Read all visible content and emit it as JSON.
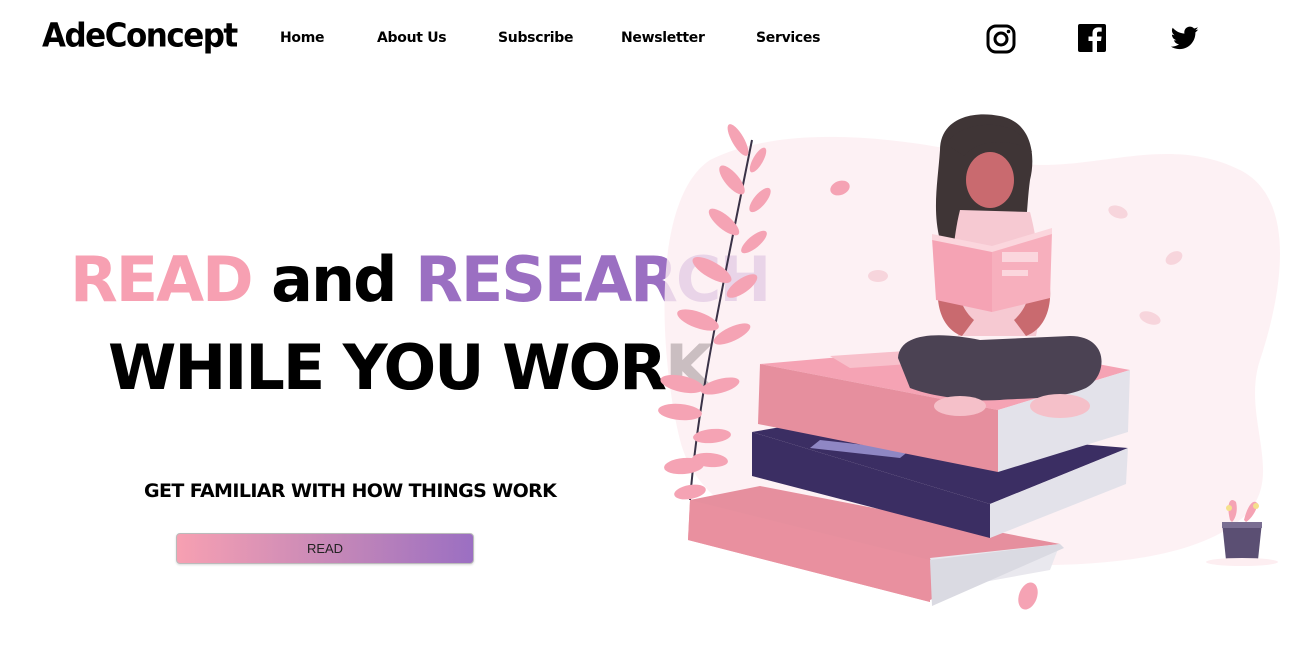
{
  "header": {
    "brand": "AdeConcept",
    "nav": [
      {
        "label": "Home"
      },
      {
        "label": "About Us"
      },
      {
        "label": "Subscribe"
      },
      {
        "label": "Newsletter"
      },
      {
        "label": "Services"
      }
    ],
    "social_icons": [
      "instagram-icon",
      "facebook-icon",
      "twitter-icon"
    ]
  },
  "hero": {
    "headline_word1": "READ",
    "headline_word2": "and",
    "headline_word3": "RESEARCH",
    "headline_line2": "WHILE YOU WORK",
    "tagline": "GET FAMILIAR WITH HOW THINGS WORK",
    "cta_label": "READ"
  },
  "colors": {
    "pink": "#f7a0b2",
    "purple": "#9b6fc2",
    "navy_book": "#3b2e63",
    "hair": "#3f3536",
    "text": "#000000"
  }
}
